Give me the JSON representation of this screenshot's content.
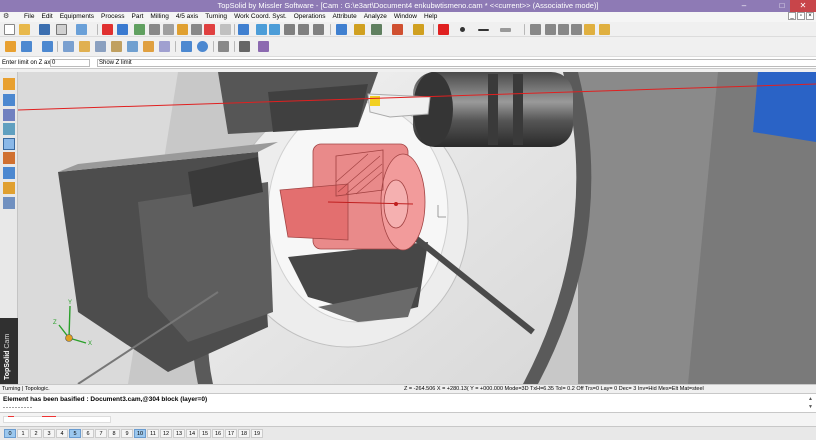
{
  "window": {
    "title": "TopSolid by Missler Software - [Cam : G:\\e3art\\Document4 enkubwtismeno.cam *  <<current>> (Associative mode)]",
    "min": "–",
    "max": "□",
    "close": "✕"
  },
  "menu": {
    "items": [
      "File",
      "Edit",
      "Equipments",
      "Process",
      "Part",
      "Milling",
      "4/5 axis",
      "Turning",
      "Work Coord. Syst.",
      "Operations",
      "Attribute",
      "Analyze",
      "Window",
      "Help"
    ],
    "win_min": "_",
    "win_restore": "▫",
    "win_close": "×"
  },
  "prompt": {
    "label": "Enter limit on Z axis=",
    "value": "0",
    "button": "Show Z limit"
  },
  "brand": {
    "name": "TopSolid",
    "module": "Cam"
  },
  "status": {
    "left": "Turning | Topologic.",
    "right": "Z = -264.506 X = +280.13( Y = +000.000 Mode=3D  TxH=6.35    Tol=  0.2    Off  Trs=0    Lay=  0    Dec= 3    Inv=Hid  Mes=Elt  Mat=steel"
  },
  "messages": {
    "line1": "Element has been basified  : Document3.cam,@304 block (layer=0)",
    "line2": "----------"
  },
  "msgscroll": {
    "up": "▲",
    "down": "▼"
  },
  "layers": [
    "0",
    "1",
    "2",
    "3",
    "4",
    "5",
    "6",
    "7",
    "8",
    "9",
    "10",
    "11",
    "12",
    "13",
    "14",
    "15",
    "16",
    "17",
    "18",
    "19"
  ],
  "active_layers": [
    "0",
    "5",
    "10"
  ],
  "axes": {
    "x": "X",
    "y": "Y",
    "z": "Z"
  },
  "colors": {
    "title": "#8e7ab5",
    "close": "#c8454a",
    "accent_red": "#e83a3a",
    "part_pink": "#e87676"
  }
}
